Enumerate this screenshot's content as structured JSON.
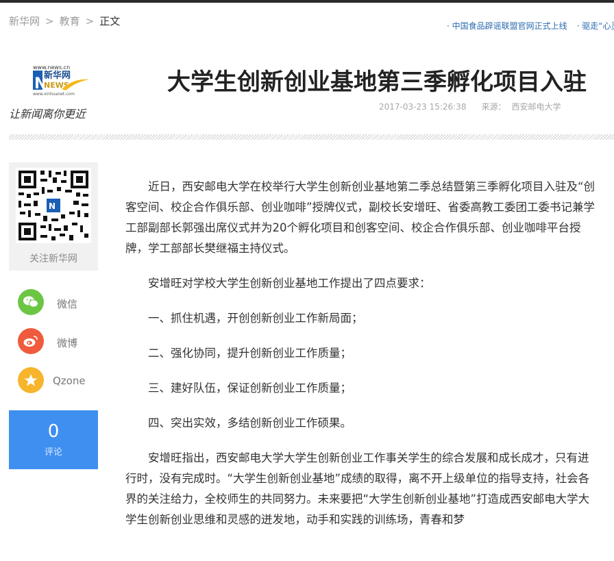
{
  "breadcrumb": {
    "site": "新华网",
    "section": "教育",
    "current": "正文",
    "separator": ">"
  },
  "ticker": {
    "items": [
      "· 中国食品辟谣联盟官网正式上线",
      "· 驱走“心灵"
    ]
  },
  "logo": {
    "url_text": "www.news.cn",
    "brand_cn": "新华网",
    "brand_en": "NEWS",
    "sub_url": "www.xinhuanet.com",
    "slogan": "让新闻离你更近"
  },
  "article": {
    "title": "大学生创新创业基地第三季孵化项目入驻",
    "datetime": "2017-03-23 15:26:38",
    "source_label": "来源：",
    "source": "西安邮电大学",
    "paragraphs": [
      "近日，西安邮电大学在校举行大学生创新创业基地第二季总结暨第三季孵化项目入驻及“创客空间、校企合作俱乐部、创业咖啡”授牌仪式，副校长安增旺、省委高教工委团工委书记兼学工部副部长郭强出席仪式并为20个孵化项目和创客空间、校企合作俱乐部、创业咖啡平台授牌，学工部部长樊继福主持仪式。",
      "安增旺对学校大学生创新创业基地工作提出了四点要求：",
      "一、抓住机遇，开创创新创业工作新局面；",
      "二、强化协同，提升创新创业工作质量；",
      "三、建好队伍，保证创新创业工作质量；",
      "四、突出实效，多结创新创业工作硕果。",
      "安增旺指出，西安邮电大学大学生创新创业工作事关学生的综合发展和成长成才，只有进行时，没有完成时。“大学生创新创业基地”成绩的取得，离不开上级单位的指导支持，社会各界的关注给力，全校师生的共同努力。未来要把“大学生创新创业基地”打造成西安邮电大学大学生创新创业思维和灵感的迸发地，动手和实践的训练场，青春和梦"
    ]
  },
  "sidebar": {
    "qr_caption": "关注新华网",
    "share": [
      {
        "label": "微信",
        "icon": "wechat-icon",
        "color": "#6cc644"
      },
      {
        "label": "微博",
        "icon": "weibo-icon",
        "color": "#ef5b3c"
      },
      {
        "label": "Qzone",
        "icon": "qzone-icon",
        "color": "#f7b52c"
      }
    ],
    "comment": {
      "count": "0",
      "label": "评论",
      "color": "#3f8ff0"
    }
  }
}
